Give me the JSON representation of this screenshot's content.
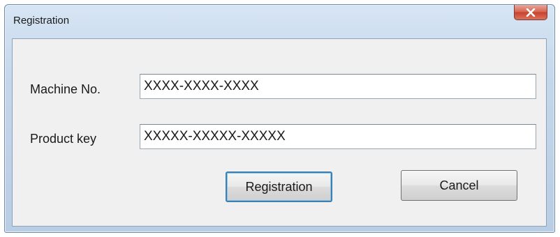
{
  "window": {
    "title": "Registration"
  },
  "form": {
    "machine_no": {
      "label": "Machine No.",
      "value": "XXXX-XXXX-XXXX"
    },
    "product_key": {
      "label": "Product key",
      "value": "XXXXX-XXXXX-XXXXX"
    }
  },
  "buttons": {
    "register_label": "Registration",
    "cancel_label": "Cancel"
  },
  "icons": {
    "close": "close-icon"
  },
  "colors": {
    "close_button": "#d6604d",
    "client_background": "#f0f0f0",
    "frame": "#c4d6ea"
  }
}
